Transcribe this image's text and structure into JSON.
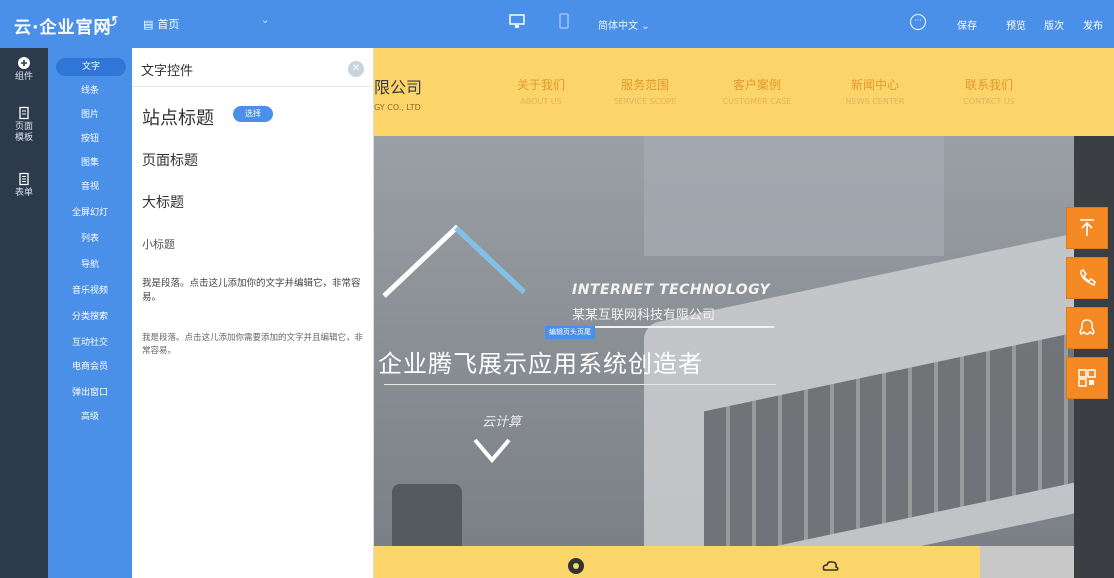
{
  "topbar": {
    "brand": "云·企业官网",
    "page_select": "首页",
    "language": "简体中文",
    "save": "保存",
    "preview": "预览",
    "history": "版次",
    "publish": "发布"
  },
  "rail": {
    "items": [
      {
        "label": "组件",
        "icon": "plus-circle-icon"
      },
      {
        "label": "页面模板",
        "icon": "page-icon"
      },
      {
        "label": "表单",
        "icon": "form-icon"
      }
    ]
  },
  "categories": [
    "文字",
    "线条",
    "图片",
    "按钮",
    "图集",
    "音视",
    "全屏幻灯",
    "列表",
    "导航",
    "音乐视频",
    "分类搜索",
    "互动社交",
    "电商会员",
    "弹出窗口",
    "高级"
  ],
  "panel": {
    "title": "文字控件",
    "site_title": "站点标题",
    "pick_label": "选择",
    "page_title": "页面标题",
    "big_title": "大标题",
    "small_title": "小标题",
    "paragraph1": "我是段落。点击这儿添加你的文字并编辑它，非常容易。",
    "paragraph2": "我是段落。点击这儿添加你需要添加的文字并且编辑它，非常容易。"
  },
  "site": {
    "company": "限公司",
    "company_en": "GY CO., LTD",
    "nav": [
      {
        "zh": "关于我们",
        "en": "ABOUT US"
      },
      {
        "zh": "服务范围",
        "en": "SERVICE SCOPE"
      },
      {
        "zh": "客户案例",
        "en": "CUSTOMER CASE"
      },
      {
        "zh": "新闻中心",
        "en": "NEWS CENTER"
      },
      {
        "zh": "联系我们",
        "en": "CONTACT US"
      }
    ],
    "hero_en": "INTERNET TECHNOLOGY",
    "hero_zh": "某某互联网科技有限公司",
    "edit_tag": "编辑页头页尾",
    "slogan": "企业腾飞展示应用系统创造者",
    "cloud": "云计算"
  },
  "colors": {
    "accent": "#4a8fe8",
    "rail": "#2d3a4b",
    "header_yellow": "#fbd46a",
    "float_orange": "#f58a24"
  },
  "floating_icons": [
    "arrow-up-icon",
    "phone-icon",
    "qq-icon",
    "qrcode-icon"
  ]
}
